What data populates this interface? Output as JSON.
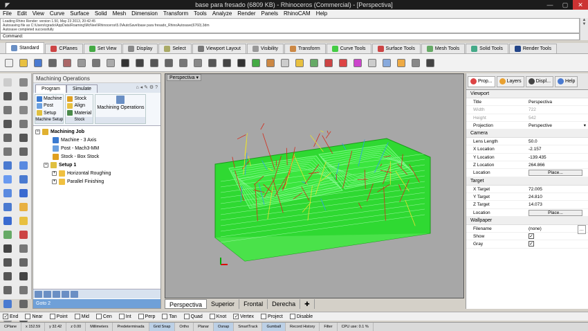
{
  "window": {
    "title": "base para fresado (6809 KB) - Rhinoceros (Commercial) - [Perspectiva]"
  },
  "menu": [
    "File",
    "Edit",
    "View",
    "Curve",
    "Surface",
    "Solid",
    "Mesh",
    "Dimension",
    "Transform",
    "Tools",
    "Analyze",
    "Render",
    "Panels",
    "RhinoCAM",
    "Help"
  ],
  "command_history": [
    "Loading Rhino Render: version 1.50, May 23 2013, 20:42:45",
    "Autosaving file as C:\\Users\\rgrado\\AppData\\Roaming\\McNeel\\Rhinoceros\\5.0\\AutoSave\\base para fresado_RhinoAutosave(6760).3dm",
    "Autosave completed successfully"
  ],
  "command_prompt": "Command:",
  "toolbar_tabs": [
    "Standard",
    "CPlanes",
    "Set View",
    "Display",
    "Select",
    "Viewport Layout",
    "Visibility",
    "Transform",
    "Curve Tools",
    "Surface Tools",
    "Mesh Tools",
    "Solid Tools",
    "Render Tools"
  ],
  "panel": {
    "title": "Machining Operations",
    "tabs": [
      "Program",
      "Simulate"
    ],
    "groups": [
      {
        "label": "Machine Setup",
        "items": [
          "Machine",
          "Post",
          "Setup"
        ]
      },
      {
        "label": "Stock",
        "items": [
          "Stock",
          "Align",
          "Material"
        ]
      },
      {
        "label": "",
        "items": [
          "Machining Operations"
        ]
      }
    ],
    "tree": [
      {
        "label": "Machining Job",
        "bold": true,
        "level": 0,
        "exp": "−",
        "color": "#e0b030"
      },
      {
        "label": "Machine - 3 Axis",
        "level": 1,
        "color": "#3a7ad0"
      },
      {
        "label": "Post - Mach3-MM",
        "level": 1,
        "color": "#6aa0e0"
      },
      {
        "label": "Stock - Box Stock",
        "level": 1,
        "color": "#e0a020"
      },
      {
        "label": "Setup 1",
        "bold": true,
        "level": 1,
        "exp": "−",
        "color": "#e0c040"
      },
      {
        "label": "Horizontal Roughing",
        "level": 2,
        "exp": "+",
        "color": "#f0c040"
      },
      {
        "label": "Parallel Finishing",
        "level": 2,
        "exp": "+",
        "color": "#f0c040"
      }
    ],
    "goto": "Goto 2"
  },
  "viewport": {
    "label": "Perspectiva",
    "tabs": [
      "Perspectiva",
      "Superior",
      "Frontal",
      "Derecha"
    ]
  },
  "props": {
    "tabs": [
      "Prop...",
      "Layers",
      "Displ...",
      "Help"
    ],
    "sections": [
      {
        "name": "Viewport",
        "rows": [
          {
            "k": "Title",
            "v": "Perspectiva"
          },
          {
            "k": "Width",
            "v": "722",
            "dis": true
          },
          {
            "k": "Height",
            "v": "542",
            "dis": true
          },
          {
            "k": "Projection",
            "v": "Perspective",
            "dd": true
          }
        ]
      },
      {
        "name": "Camera",
        "rows": [
          {
            "k": "Lens Length",
            "v": "50.0"
          },
          {
            "k": "X Location",
            "v": "-2.157"
          },
          {
            "k": "Y Location",
            "v": "-139.435"
          },
          {
            "k": "Z Location",
            "v": "264.866"
          },
          {
            "k": "Location",
            "v": "Place...",
            "btn": true
          }
        ]
      },
      {
        "name": "Target",
        "rows": [
          {
            "k": "X Target",
            "v": "72.005"
          },
          {
            "k": "Y Target",
            "v": "24.810"
          },
          {
            "k": "Z Target",
            "v": "14.073"
          },
          {
            "k": "Location",
            "v": "Place...",
            "btn": true
          }
        ]
      },
      {
        "name": "Wallpaper",
        "rows": [
          {
            "k": "Filename",
            "v": "(none)",
            "more": true
          },
          {
            "k": "Show",
            "v": "✓",
            "chk": true
          },
          {
            "k": "Gray",
            "v": "✓",
            "chk": true
          }
        ]
      }
    ]
  },
  "osnap": [
    {
      "l": "End",
      "c": true
    },
    {
      "l": "Near",
      "c": false
    },
    {
      "l": "Point",
      "c": false
    },
    {
      "l": "Mid",
      "c": false
    },
    {
      "l": "Cen",
      "c": false
    },
    {
      "l": "Int",
      "c": false
    },
    {
      "l": "Perp",
      "c": false
    },
    {
      "l": "Tan",
      "c": false
    },
    {
      "l": "Quad",
      "c": false
    },
    {
      "l": "Knot",
      "c": false
    },
    {
      "l": "Vertex",
      "c": true
    },
    {
      "l": "Project",
      "c": false
    },
    {
      "l": "Disable",
      "c": false
    }
  ],
  "status": [
    {
      "t": "CPlane"
    },
    {
      "t": "x 152.59"
    },
    {
      "t": "y 32.42"
    },
    {
      "t": "z 0.00"
    },
    {
      "t": "Millimeters"
    },
    {
      "t": "Predeterminada"
    },
    {
      "t": "Grid Snap",
      "on": true
    },
    {
      "t": "Ortho"
    },
    {
      "t": "Planar"
    },
    {
      "t": "Osnap",
      "on": true
    },
    {
      "t": "SmartTrack"
    },
    {
      "t": "Gumball",
      "on": true
    },
    {
      "t": "Record History"
    },
    {
      "t": "Filter"
    },
    {
      "t": "CPU use: 0.1 %"
    }
  ],
  "colors": {
    "green": "#39e53a",
    "toolpath_red": "#d42a1a",
    "toolpath_yellow": "#e8e030",
    "bg": "#a7a7a7"
  }
}
